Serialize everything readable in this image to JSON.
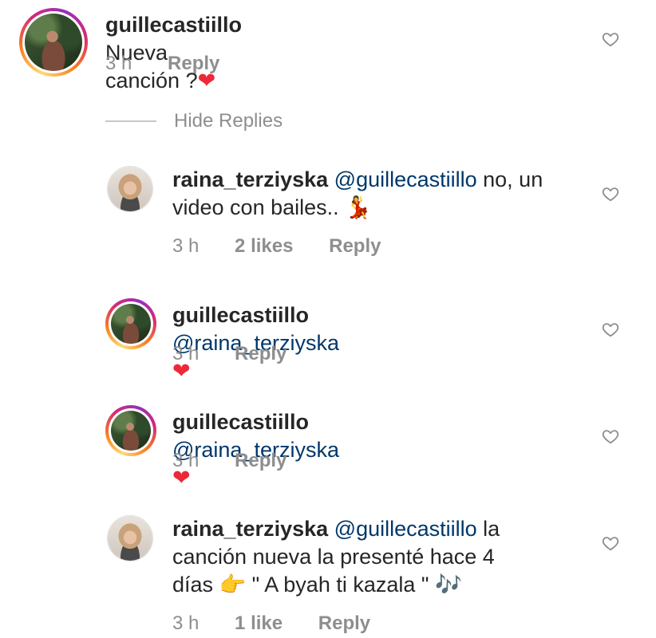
{
  "comments": [
    {
      "username": "guillecastiillo",
      "text": "Nueva canción ?",
      "emoji": "❤",
      "time": "3 h",
      "reply": "Reply"
    },
    {
      "username": "raina_terziyska",
      "mention": "@guillecastiillo",
      "text_line1_rest": " no, un",
      "text_line2": "video con bailes.. ",
      "emoji": "💃",
      "time": "3 h",
      "likes": "2 likes",
      "reply": "Reply"
    },
    {
      "username": "guillecastiillo",
      "mention": "@raina_terziyska",
      "emoji": "❤",
      "time": "3 h",
      "reply": "Reply"
    },
    {
      "username": "guillecastiillo",
      "mention": "@raina_terziyska",
      "emoji": "❤",
      "time": "3 h",
      "reply": "Reply"
    },
    {
      "username": "raina_terziyska",
      "mention": "@guillecastiillo",
      "text_line1_rest": " la",
      "text_line2": "canción nueva  la presenté hace 4",
      "text_line3": "días ",
      "emoji_point": "👉",
      "text_line3_rest": " \" A byah ti kazala \" ",
      "emoji_notes": "🎶",
      "time": "3 h",
      "likes": "1 like",
      "reply": "Reply"
    }
  ],
  "hide_replies": "Hide Replies",
  "icons": {
    "like": "heart-outline-icon"
  },
  "colors": {
    "mention": "#00376b",
    "meta": "#8e8e8e",
    "heart": "#ed2939"
  }
}
